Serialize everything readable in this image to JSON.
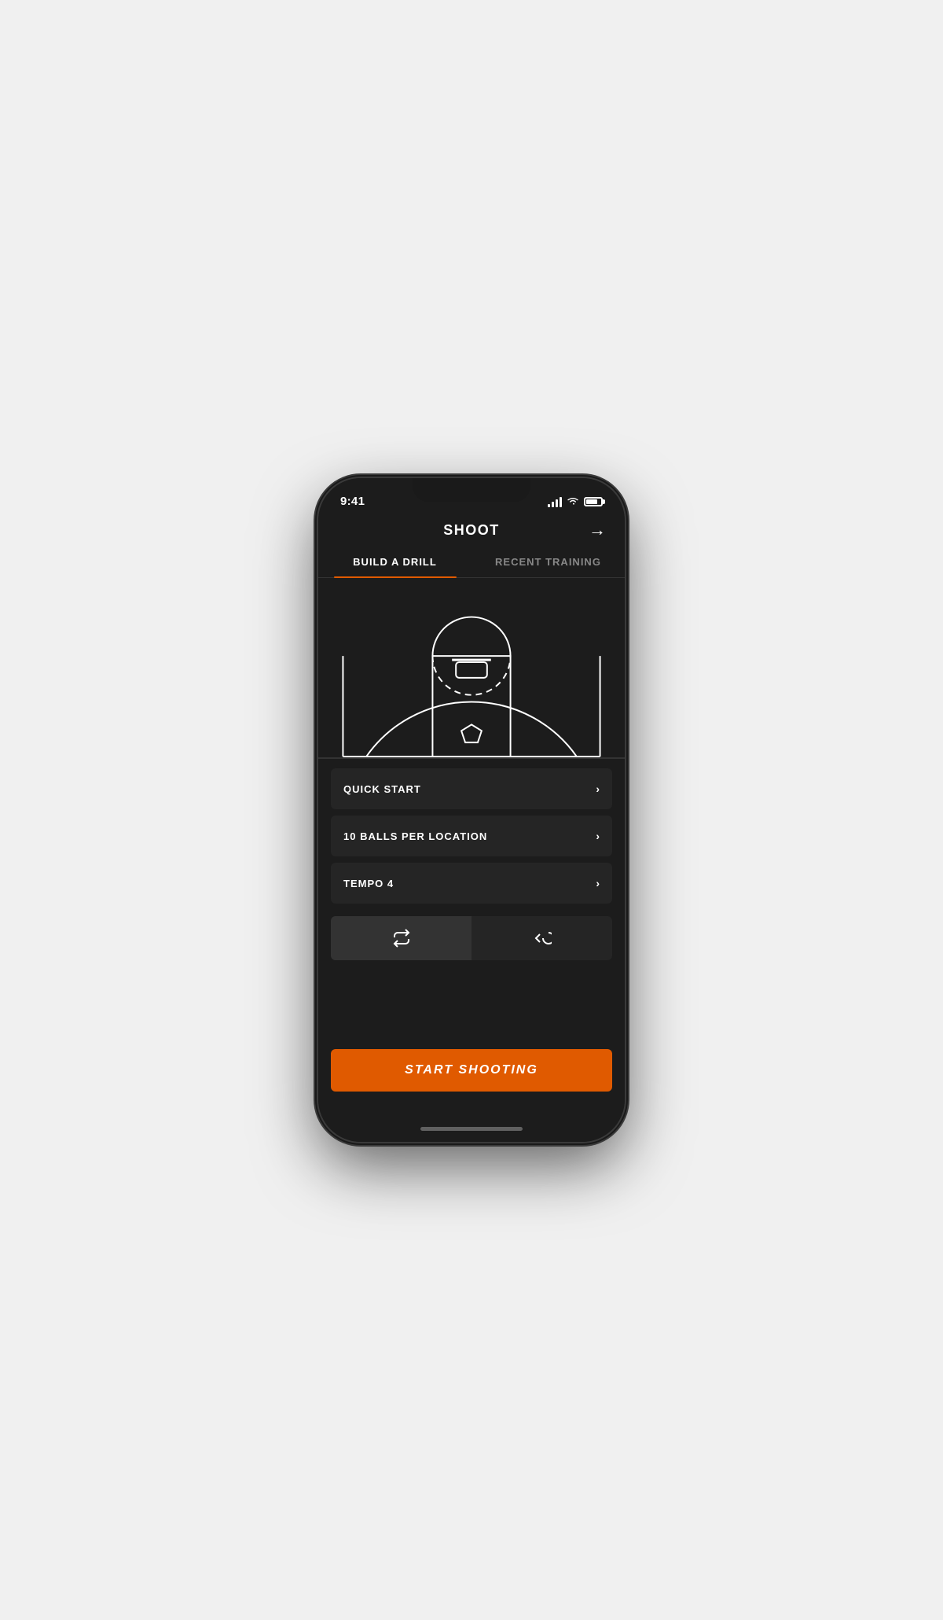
{
  "statusBar": {
    "time": "9:41",
    "batteryLevel": 75
  },
  "header": {
    "title": "SHOOT",
    "arrowLabel": "→"
  },
  "tabs": [
    {
      "id": "build-a-drill",
      "label": "BUILD A DRILL",
      "active": true
    },
    {
      "id": "recent-training",
      "label": "RECENT TRAINING",
      "active": false
    }
  ],
  "options": [
    {
      "id": "quick-start",
      "label": "QUICK START"
    },
    {
      "id": "balls-per-location",
      "label": "10 BALLS PER LOCATION"
    },
    {
      "id": "tempo",
      "label": "TEMPO  4"
    }
  ],
  "toggles": [
    {
      "id": "repeat",
      "icon": "repeat"
    },
    {
      "id": "undo",
      "icon": "undo"
    }
  ],
  "startButton": {
    "label": "START SHOOTING"
  }
}
